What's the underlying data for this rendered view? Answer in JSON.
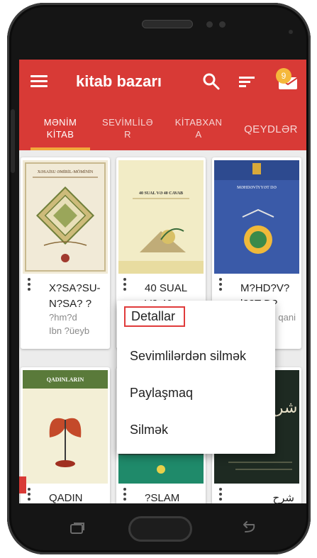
{
  "app": {
    "title": "kitab bazarı",
    "badge_count": "9",
    "accent_color": "#d83a36",
    "tab_indicator_color": "#f2a83c"
  },
  "tabs": [
    {
      "line1": "MƏNİM",
      "line2": "KİTAB",
      "active": true
    },
    {
      "line1": "SEVİMLİLƏ",
      "line2": "R",
      "active": false
    },
    {
      "line1": "KİTABXAN",
      "line2": "A",
      "active": false
    },
    {
      "line1": "QEYDLƏR",
      "line2": "",
      "active": false
    }
  ],
  "books": [
    {
      "title_line1": "X?SA?SU-",
      "title_line2": "N?SA? ?",
      "author_line1": "?hm?d",
      "author_line2": "Ibn ?üeyb"
    },
    {
      "title_line1": "40 SUAL",
      "title_line2": "V? 40",
      "author_line1": "",
      "author_line2": ""
    },
    {
      "title_line1": "M?HD?V?",
      "title_line2": "l??T D?",
      "author_line1": "",
      "author_line2": "qani"
    },
    {
      "title_line1": "QADIN",
      "title_line2": "",
      "author_line1": "",
      "author_line2": ""
    },
    {
      "title_line1": "?SLAM",
      "title_line2": "",
      "author_line1": "",
      "author_line2": ""
    },
    {
      "title_line1": "شرح",
      "title_line2": "",
      "author_line1": "",
      "author_line2": ""
    }
  ],
  "covers": {
    "cover1_heading": "XƏSAİSU ƏMİRİL-MÖMİNİN",
    "cover2_heading": "40 SUAL VƏ 40 CAVAB",
    "cover3_heading": "MƏHDƏVİYYƏT DƏ",
    "cover4_heading": "QADINLARIN",
    "cover6_heading": "شرح"
  },
  "context_menu": {
    "items": [
      "Detallar",
      "Sevimlilərdən silmək",
      "Paylaşmaq",
      "Silmək"
    ],
    "highlighted": "Detallar"
  },
  "icons": {
    "menu": "hamburger-icon",
    "search": "search-icon",
    "sort": "sort-icon",
    "mail": "mail-icon",
    "more": "more-vert-icon",
    "home": "home-button",
    "recent": "recent-apps-icon",
    "back": "back-icon"
  }
}
